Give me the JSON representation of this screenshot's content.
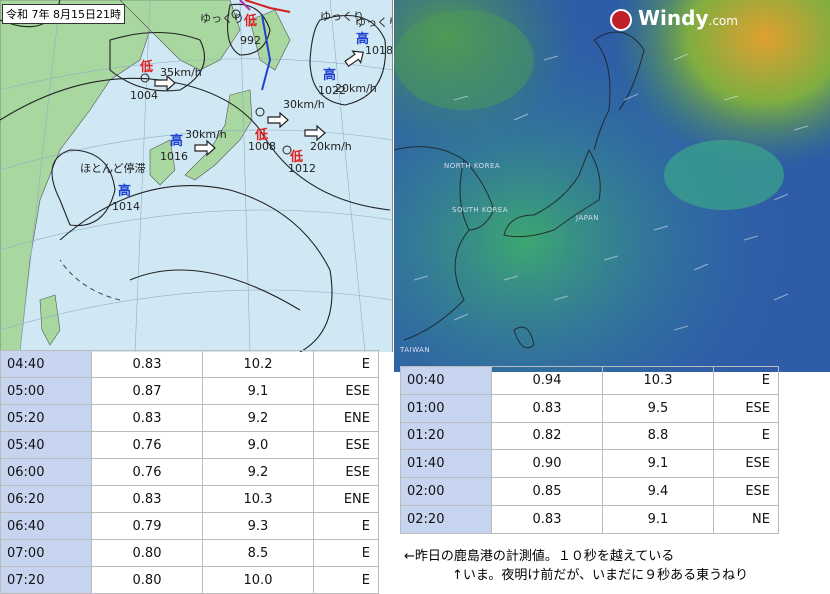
{
  "weather_chart": {
    "title": "令和 7年 8月15日21時",
    "labels": {
      "low1_speed": "35km/h",
      "low1_pressure": "1004",
      "slow1": "ゆっくり",
      "low2_pressure": "992",
      "slow2": "ゆっくり",
      "slow3": "ゆっくり",
      "high_ne_pressure": "1018",
      "high_ne2_pressure": "1022",
      "high_ne_speed": "20km/h",
      "low3_speed": "30km/h",
      "low3_pressure": "1008",
      "low4_speed": "20km/h",
      "low4_pressure": "1012",
      "high_center_speed": "30km/h",
      "high_center_pressure": "1016",
      "high_w_slow": "ほとんど停滞",
      "high_w_pressure": "1014"
    },
    "glyphs": {
      "low": "低",
      "high": "高"
    }
  },
  "windy": {
    "brand": "Windy",
    "brand_suffix": ".com",
    "map_names": {
      "north_korea": "NORTH KOREA",
      "south_korea": "SOUTH KOREA",
      "japan": "JAPAN",
      "taiwan": "TAIWAN"
    }
  },
  "table_left": [
    {
      "time": "04:40",
      "value": "0.83",
      "period": "10.2",
      "dir": "E"
    },
    {
      "time": "05:00",
      "value": "0.87",
      "period": "9.1",
      "dir": "ESE"
    },
    {
      "time": "05:20",
      "value": "0.83",
      "period": "9.2",
      "dir": "ENE"
    },
    {
      "time": "05:40",
      "value": "0.76",
      "period": "9.0",
      "dir": "ESE"
    },
    {
      "time": "06:00",
      "value": "0.76",
      "period": "9.2",
      "dir": "ESE"
    },
    {
      "time": "06:20",
      "value": "0.83",
      "period": "10.3",
      "dir": "ENE"
    },
    {
      "time": "06:40",
      "value": "0.79",
      "period": "9.3",
      "dir": "E"
    },
    {
      "time": "07:00",
      "value": "0.80",
      "period": "8.5",
      "dir": "E"
    },
    {
      "time": "07:20",
      "value": "0.80",
      "period": "10.0",
      "dir": "E"
    }
  ],
  "table_right": [
    {
      "time": "00:40",
      "value": "0.94",
      "period": "10.3",
      "dir": "E"
    },
    {
      "time": "01:00",
      "value": "0.83",
      "period": "9.5",
      "dir": "ESE"
    },
    {
      "time": "01:20",
      "value": "0.82",
      "period": "8.8",
      "dir": "E"
    },
    {
      "time": "01:40",
      "value": "0.90",
      "period": "9.1",
      "dir": "ESE"
    },
    {
      "time": "02:00",
      "value": "0.85",
      "period": "9.4",
      "dir": "ESE"
    },
    {
      "time": "02:20",
      "value": "0.83",
      "period": "9.1",
      "dir": "NE"
    }
  ],
  "notes": {
    "line1": "←昨日の鹿島港の計測値。１０秒を越えている",
    "line2": "↑いま。夜明け前だが、いまだに９秒ある東うねり"
  }
}
